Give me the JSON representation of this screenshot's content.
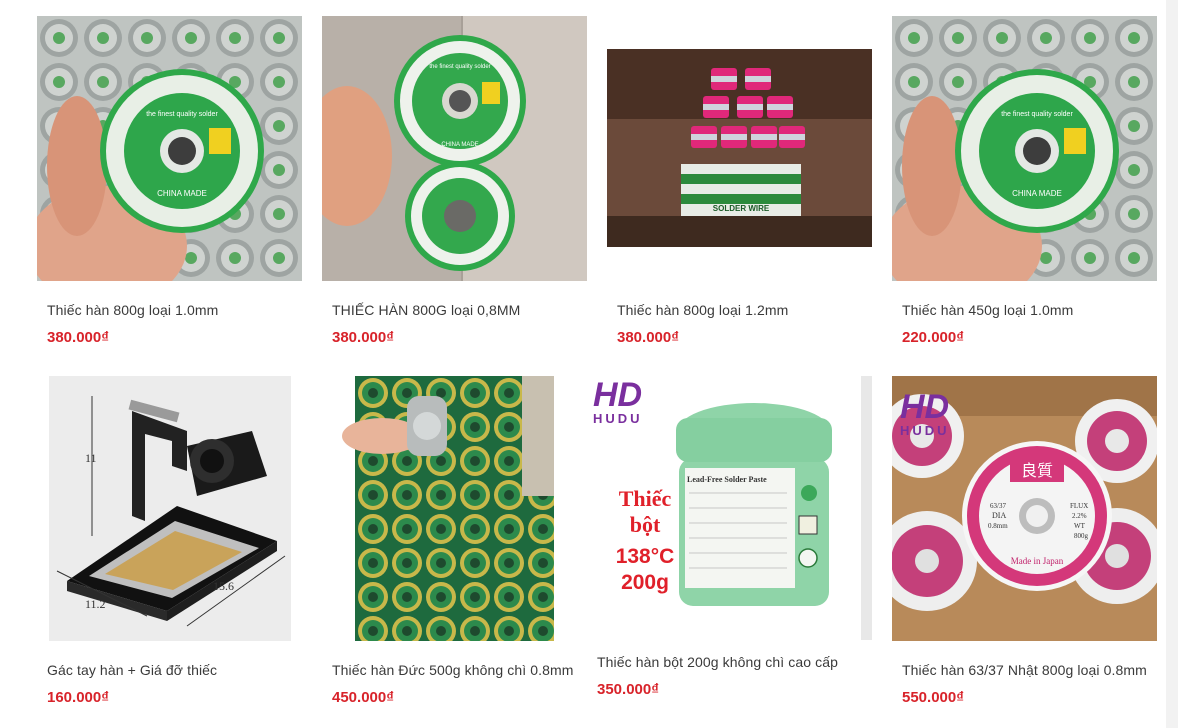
{
  "products": [
    {
      "name": "Thiếc hàn 800g loại 1.0mm",
      "price": "380.000₫",
      "image_text": [
        "the finest quality solder",
        "CHINA MADE"
      ]
    },
    {
      "name": "THIẾC HÀN 800G loại 0,8MM",
      "price": "380.000₫",
      "image_text": [
        "the finest quality solder",
        "CHINA MADE"
      ]
    },
    {
      "name": "Thiếc hàn 800g loại 1.2mm",
      "price": "380.000₫",
      "image_text": [
        "SOLDER WIRE"
      ]
    },
    {
      "name": "Thiếc hàn 450g loại 1.0mm",
      "price": "220.000₫",
      "image_text": [
        "the finest quality solder",
        "CHINA MADE"
      ]
    },
    {
      "name": "Gác tay hàn + Giá đỡ thiếc",
      "price": "160.000₫",
      "image_text": [
        "11",
        "11.2",
        "15.6"
      ]
    },
    {
      "name": "Thiếc hàn Đức 500g không chì 0.8mm",
      "price": "450.000₫",
      "image_text": []
    },
    {
      "name": "Thiếc hàn bột 200g không chì cao cấp",
      "price": "350.000₫",
      "image_text": [
        "HUDU",
        "Thiếc",
        "bột",
        "138°C",
        "200g",
        "Lead-Free Solder Paste"
      ]
    },
    {
      "name": "Thiếc hàn 63/37 Nhật 800g loại 0.8mm",
      "price": "550.000₫",
      "image_text": [
        "HUDU",
        "良質",
        "63/37",
        "DIA",
        "0.8mm",
        "FLUX",
        "2.2%",
        "WT",
        "800g",
        "Made in Japan"
      ]
    }
  ],
  "colors": {
    "price": "#d8232a",
    "name": "#3a3a3a",
    "brand": "#7a2f9e"
  }
}
